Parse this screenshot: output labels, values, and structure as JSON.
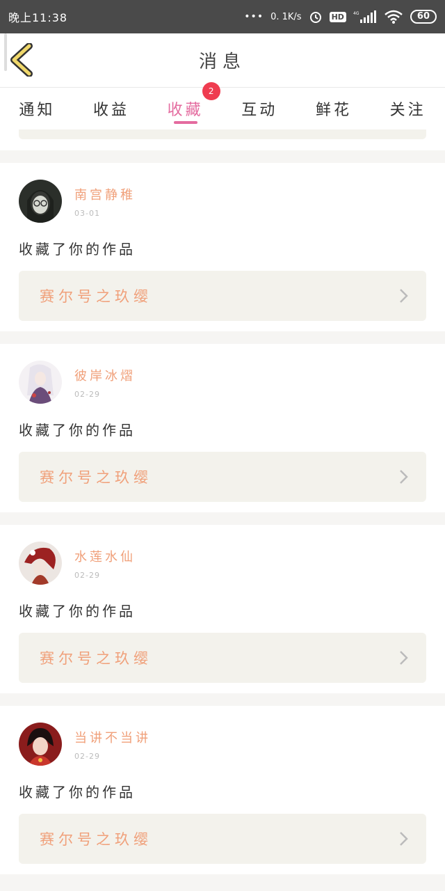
{
  "status_bar": {
    "time": "晚上11:38",
    "network_speed": "0. 1K/s",
    "hd": "HD",
    "signal_label": "4G",
    "battery": "60"
  },
  "header": {
    "title": "消息"
  },
  "tabs": [
    {
      "label": "通知"
    },
    {
      "label": "收益"
    },
    {
      "label": "收藏",
      "badge": "2",
      "active": true
    },
    {
      "label": "互动"
    },
    {
      "label": "鲜花"
    },
    {
      "label": "关注"
    }
  ],
  "notifications": [
    {
      "username": "南宫静稚",
      "date": "03-01",
      "action": "收藏了你的作品",
      "work_title": "赛尔号之玖缨"
    },
    {
      "username": "彼岸冰熠",
      "date": "02-29",
      "action": "收藏了你的作品",
      "work_title": "赛尔号之玖缨"
    },
    {
      "username": "水莲水仙",
      "date": "02-29",
      "action": "收藏了你的作品",
      "work_title": "赛尔号之玖缨"
    },
    {
      "username": "当讲不当讲",
      "date": "02-29",
      "action": "收藏了你的作品",
      "work_title": "赛尔号之玖缨"
    }
  ],
  "colors": {
    "accent_pink": "#e46b9f",
    "username_orange": "#f0a07a",
    "badge_red": "#ef3c50",
    "back_icon_yellow": "#f0d86b"
  }
}
